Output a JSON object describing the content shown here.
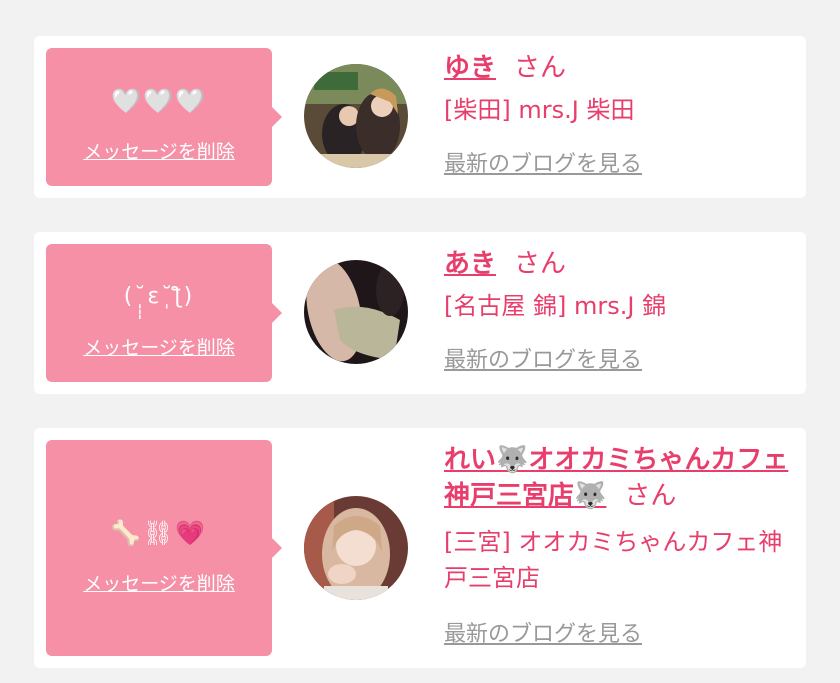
{
  "colors": {
    "accent": "#e83e6c",
    "bubble": "#f590a6",
    "link_gray": "#999999",
    "background": "#f2f2f2"
  },
  "delete_label": "メッセージを削除",
  "blog_label": "最新のブログを見る",
  "honorific": "さん",
  "items": [
    {
      "message": "🤍🤍🤍",
      "name": "ゆき",
      "shop": "[柴田] mrs.J 柴田"
    },
    {
      "message": "(˘̩̩̩ε˘̩ƪ)",
      "name": "あき",
      "shop": "[名古屋 錦] mrs.J 錦"
    },
    {
      "message": "🦴⛓💗",
      "name": "れい🐺オオカミちゃんカフェ神戸三宮店🐺",
      "shop": "[三宮] オオカミちゃんカフェ神戸三宮店"
    }
  ]
}
